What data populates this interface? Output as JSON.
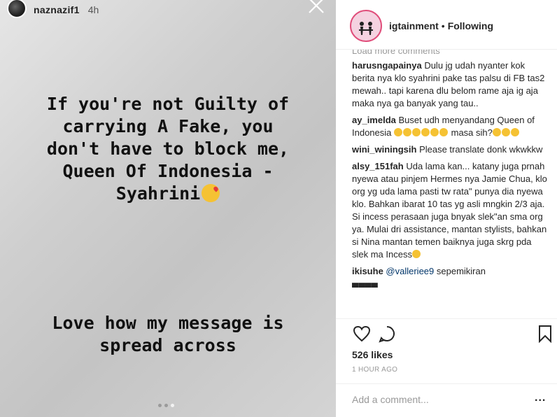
{
  "story": {
    "username": "naznazif1",
    "time": "4h",
    "text1_lines": [
      "If you're not Guilty of",
      "carrying A Fake, you",
      "don't have to block me,",
      "Queen Of Indonesia -",
      "Syahrini"
    ],
    "text2_lines": [
      "Love how my message is",
      "spread across"
    ]
  },
  "post": {
    "account": "igtainment",
    "separator": "•",
    "follow_state": "Following",
    "load_more": "Load more comments",
    "comments": [
      {
        "user": "harusngapainya",
        "text": " Dulu jg udah nyanter kok berita nya klo syahrini pake tas palsu di FB tas2 mewah.. tapi karena dlu belom rame aja ig aja maka nya ga banyak yang tau.."
      },
      {
        "user": "ay_imelda",
        "text_before": " Buset udh menyandang Queen of Indonesia ",
        "text_after": " masa sih?"
      },
      {
        "user": "wini_winingsih",
        "text": " Please translate donk wkwkkw"
      },
      {
        "user": "alsy_151fah",
        "text": " Uda lama kan... katany juga prnah nyewa atau pinjem Hermes nya Jamie Chua, klo org yg uda lama pasti tw rata\" punya dia nyewa klo. Bahkan ibarat 10 tas yg asli mngkin 2/3 aja. Si incess perasaan juga bnyak slek\"an sma org ya. Mulai dri assistance, mantan stylists, bahkan si Nina mantan temen baiknya juga skrg pda slek ma Incess"
      },
      {
        "user": "ikisuhe",
        "mention": "@vallerieе9",
        "text": " sepemikiran"
      }
    ],
    "likes": "526 likes",
    "time_ago": "1 HOUR AGO",
    "add_comment_placeholder": "Add a comment...",
    "more_options": "..."
  }
}
